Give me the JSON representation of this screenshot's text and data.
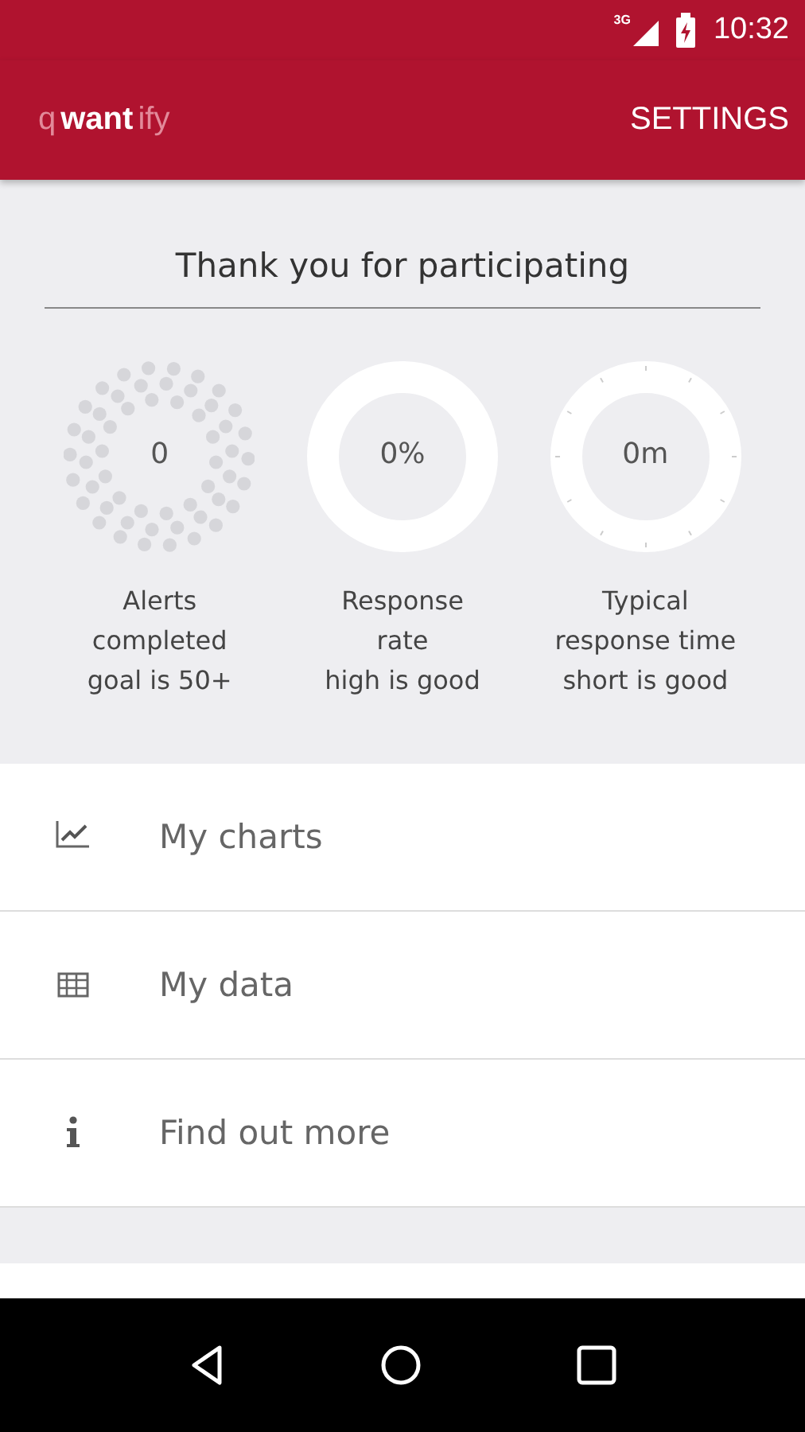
{
  "status_bar": {
    "network": "3G",
    "time": "10:32"
  },
  "app_bar": {
    "logo": [
      {
        "text": "q",
        "kind": "light"
      },
      {
        "text": "want",
        "kind": "bold"
      },
      {
        "text": "ify",
        "kind": "light"
      }
    ],
    "action": "SETTINGS"
  },
  "heading": "Thank you for participating",
  "stats": [
    {
      "kind": "dots",
      "value": "0",
      "lines": [
        "Alerts",
        "completed",
        "goal is 50+"
      ]
    },
    {
      "kind": "ring",
      "value": "0%",
      "lines": [
        "Response",
        "rate",
        "high is good"
      ]
    },
    {
      "kind": "clock",
      "value": "0m",
      "lines": [
        "Typical",
        "response time",
        "short is good"
      ]
    }
  ],
  "menu": [
    {
      "kind": "chart",
      "label": "My charts"
    },
    {
      "kind": "table",
      "label": "My data"
    },
    {
      "kind": "info",
      "label": "Find out more"
    }
  ]
}
